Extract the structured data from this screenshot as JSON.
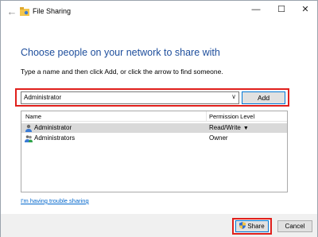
{
  "window": {
    "title": "File Sharing",
    "controls": {
      "minimize": "—",
      "maximize": "☐",
      "close": "✕"
    },
    "back_icon": "back-arrow-icon"
  },
  "heading": "Choose people on your network to share with",
  "instructions": "Type a name and then click Add, or click the arrow to find someone.",
  "name_combo": {
    "value": "Administrator",
    "arrow": "∨"
  },
  "add_button": "Add",
  "list": {
    "columns": [
      "Name",
      "Permission Level"
    ],
    "rows": [
      {
        "name": "Administrator",
        "permission": "Read/Write",
        "has_dropdown": true,
        "selected": true,
        "icon": "user-icon"
      },
      {
        "name": "Administrators",
        "permission": "Owner",
        "has_dropdown": false,
        "selected": false,
        "icon": "group-icon"
      }
    ],
    "dropdown_glyph": "▼"
  },
  "trouble_link": "I'm having trouble sharing",
  "footer": {
    "share": "Share",
    "cancel": "Cancel"
  },
  "colors": {
    "heading": "#1e4e9c",
    "highlight": "#e0201c",
    "link": "#0066cc",
    "selected_row": "#d9d9d9"
  }
}
